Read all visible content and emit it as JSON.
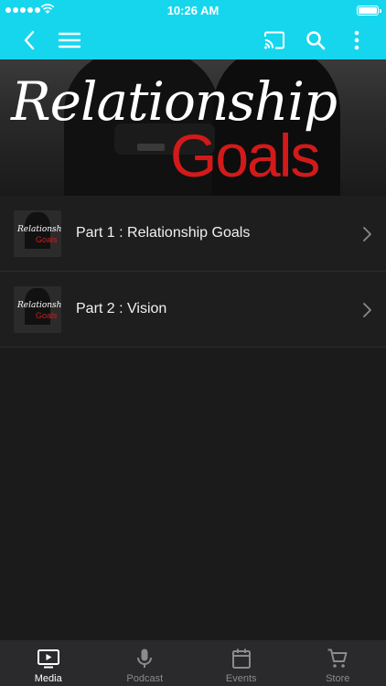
{
  "status_bar": {
    "time": "10:26 AM"
  },
  "toolbar": {
    "back_icon": "chevron-left-icon",
    "menu_icon": "hamburger-menu-icon",
    "cast_icon": "cast-icon",
    "search_icon": "search-icon",
    "more_icon": "more-vertical-icon"
  },
  "hero": {
    "title_line1": "Relationship",
    "title_line2": "Goals"
  },
  "media": {
    "items": [
      {
        "label": "Part 1 : Relationship Goals",
        "thumb_line1": "Relationship",
        "thumb_line2": "Goals"
      },
      {
        "label": "Part 2 : Vision",
        "thumb_line1": "Relationship",
        "thumb_line2": "Goals"
      }
    ]
  },
  "tabs": [
    {
      "label": "Media",
      "icon": "tv-play-icon",
      "active": true
    },
    {
      "label": "Podcast",
      "icon": "microphone-icon",
      "active": false
    },
    {
      "label": "Events",
      "icon": "calendar-icon",
      "active": false
    },
    {
      "label": "Store",
      "icon": "cart-icon",
      "active": false
    }
  ],
  "colors": {
    "accent": "#16d6ee",
    "title_red": "#d21a1a",
    "background": "#1b1b1c",
    "tab_bar": "#2a2a2c"
  }
}
